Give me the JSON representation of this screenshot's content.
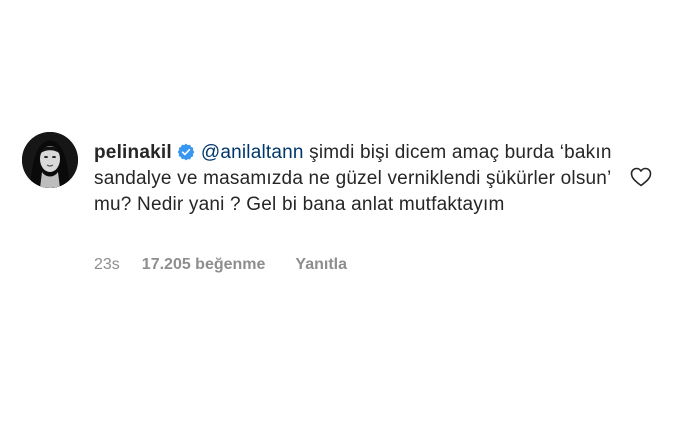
{
  "comment": {
    "username": "pelinakil",
    "verified": true,
    "mention": "@anilaltann",
    "text": " şimdi bişi dicem amaç burda ‘bakın sandalye ve masamızda ne güzel verniklendi şükürler olsun’ mu? Nedir yani ? Gel bi bana anlat mutfaktayım",
    "time": "23s",
    "likes": "17.205 beğenme",
    "reply_label": "Yanıtla",
    "icons": {
      "verified": "verified-badge-icon",
      "like": "heart-outline-icon"
    },
    "colors": {
      "verified": "#3897f0",
      "mention": "#00376b",
      "meta": "#8e8e8e"
    }
  }
}
